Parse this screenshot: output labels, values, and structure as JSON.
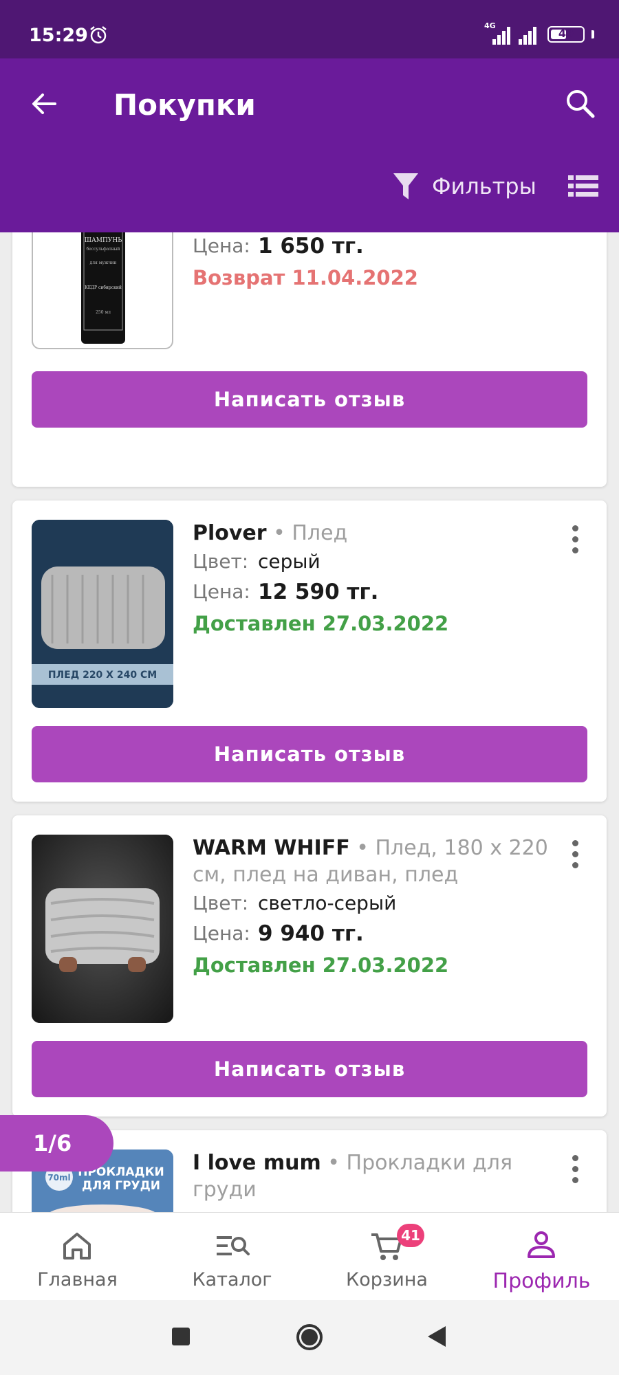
{
  "status_bar": {
    "time": "15:29",
    "network": "4G",
    "battery": "49",
    "battery_fraction": 0.49
  },
  "header": {
    "title": "Покупки",
    "filters_label": "Фильтры"
  },
  "orders": [
    {
      "price_label": "Цена:",
      "price": "1 650 тг.",
      "status": "Возврат 11.04.2022",
      "status_type": "return",
      "review_label": "Написать отзыв",
      "image_text": [
        "ШАМПУНЬ",
        "бессульфатный",
        "для мужчин",
        "КЕДР сибирский",
        "250 мл"
      ]
    },
    {
      "brand": "Plover",
      "category": "Плед",
      "color_label": "Цвет:",
      "color": "серый",
      "price_label": "Цена:",
      "price": "12 590 тг.",
      "status": "Доставлен 27.03.2022",
      "status_type": "delivered",
      "review_label": "Написать отзыв",
      "image_text": "ПЛЕД 220 X 240 СМ"
    },
    {
      "brand": "WARM WHIFF",
      "category": "Плед, 180 х 220 см, плед на диван, плед",
      "color_label": "Цвет:",
      "color": "светло-серый",
      "price_label": "Цена:",
      "price": "9 940 тг.",
      "status": "Доставлен 27.03.2022",
      "status_type": "delivered",
      "review_label": "Написать отзыв"
    },
    {
      "brand": "I love mum",
      "category": "Прокладки для груди",
      "image_text": [
        "70ml",
        "ПРОКЛАДКИ",
        "ДЛЯ ГРУДИ"
      ]
    }
  ],
  "pagination": "1/6",
  "bottom_nav": [
    {
      "label": "Главная",
      "icon": "home-icon"
    },
    {
      "label": "Каталог",
      "icon": "catalog-search-icon"
    },
    {
      "label": "Корзина",
      "icon": "cart-icon",
      "badge": "41"
    },
    {
      "label": "Профиль",
      "icon": "profile-icon",
      "active": true
    }
  ],
  "colors": {
    "status_bar": "#4f1773",
    "app_bar": "#6a1b9a",
    "accent_button": "#ab47bc",
    "active_nav": "#9c27b0",
    "delivered": "#43a047",
    "returned": "#e57373",
    "badge": "#ec407a"
  }
}
